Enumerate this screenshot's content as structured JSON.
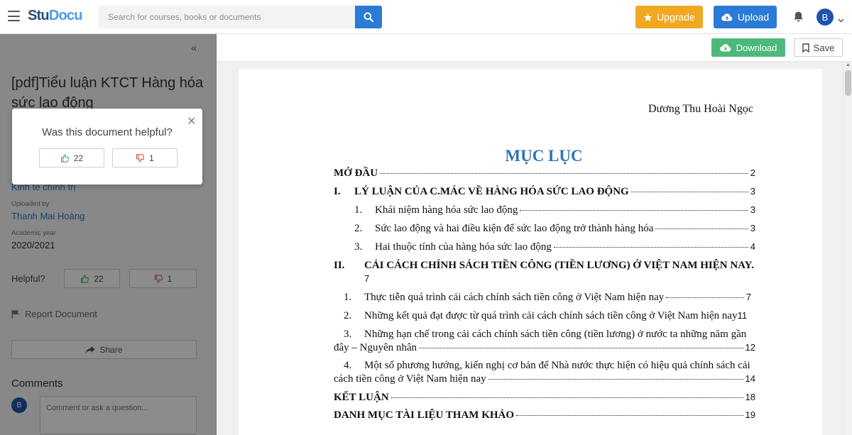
{
  "header": {
    "logo_text_1": "Stu",
    "logo_text_2": "Docu",
    "search_placeholder": "Search for courses, books or documents",
    "upgrade_label": "Upgrade",
    "upload_label": "Upload",
    "avatar_initial": "B"
  },
  "sidebar": {
    "title": "[pdf]Tiểu luận KTCT Hàng hóa sức lao động",
    "course_value": "Kinh tế chính trị",
    "uploaded_by_label": "Uploaded by",
    "uploaded_by_value": "Thanh Mai Hoàng",
    "academic_year_label": "Academic year",
    "academic_year_value": "2020/2021",
    "helpful_label": "Helpful?",
    "helpful_up": "22",
    "helpful_down": "1",
    "report_label": "Report Document",
    "share_label": "Share",
    "comments_label": "Comments",
    "comment_avatar": "B",
    "comment_placeholder": "Comment or ask a question..."
  },
  "popup": {
    "question": "Was this document helpful?",
    "up_count": "22",
    "down_count": "1"
  },
  "docbar": {
    "download_label": "Download",
    "save_label": "Save"
  },
  "document": {
    "author": "Dương Thu Hoài Ngọc",
    "toc_title": "MỤC LỤC",
    "entries": [
      {
        "num": "",
        "text": "MỞ ĐẦU",
        "page": "2"
      },
      {
        "num": "I.",
        "text": "LÝ LUẬN CỦA C.MÁC VỀ HÀNG HÓA SỨC LAO ĐỘNG",
        "page": "3"
      },
      {
        "num": "1.",
        "text": "Khái niệm hàng hóa sức lao động",
        "page": "3"
      },
      {
        "num": "2.",
        "text": "Sức lao động và hai điều kiện để sức lao động trở thành hàng hóa",
        "page": "3"
      },
      {
        "num": "3.",
        "text": "Hai thuộc tính của hàng hóa sức lao động",
        "page": "4"
      },
      {
        "num": "II.",
        "text": "CẢI CÁCH CHÍNH SÁCH TIỀN CÔNG (TIỀN LƯƠNG) Ở VIỆT NAM HIỆN NAY.",
        "page": "7"
      },
      {
        "num": "1.",
        "text": "Thực tiễn quá trình cải cách chính sách tiền công ở Việt Nam hiện nay",
        "page": "7"
      },
      {
        "num": "2.",
        "text": "Những kết quả đạt được từ quá trình cải cách chính sách tiền công ở Việt Nam hiện nay",
        "page": "11"
      },
      {
        "num": "3.",
        "text": "Những hạn chế trong cải cách chính sách tiền công (tiền lương) ở nước ta những năm gần",
        "text2": "đây – Nguyên nhân",
        "page": "12"
      },
      {
        "num": "4.",
        "text": "Một số phương hướng, kiến nghị cơ bản để Nhà nước thực hiện có hiệu quả chính sách cải",
        "text2": "cách tiền công ở Việt Nam hiện nay",
        "page": "14"
      },
      {
        "num": "",
        "text": "KẾT LUẬN",
        "page": "18"
      },
      {
        "num": "",
        "text": "DANH MỤC TÀI LIỆU THAM KHẢO",
        "page": "19"
      }
    ]
  }
}
